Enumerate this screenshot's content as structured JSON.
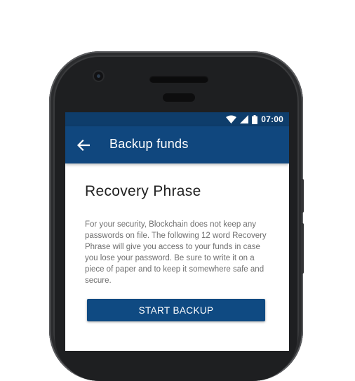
{
  "status_bar": {
    "time": "07:00",
    "icons": [
      "wifi-icon",
      "signal-icon",
      "battery-icon"
    ]
  },
  "app_bar": {
    "back_icon": "arrow-left-icon",
    "title": "Backup funds"
  },
  "content": {
    "heading": "Recovery Phrase",
    "description": "For your security, Blockchain does not keep any passwords on file. The following 12 word Recovery Phrase will give you access to your funds in case you lose your password. Be sure to write it on a piece of paper and to keep it somewhere safe and secure.",
    "start_button_label": "START BACKUP"
  },
  "colors": {
    "status_bar": "#0e3d6b",
    "app_bar": "#10477e",
    "button": "#0f4a82"
  }
}
